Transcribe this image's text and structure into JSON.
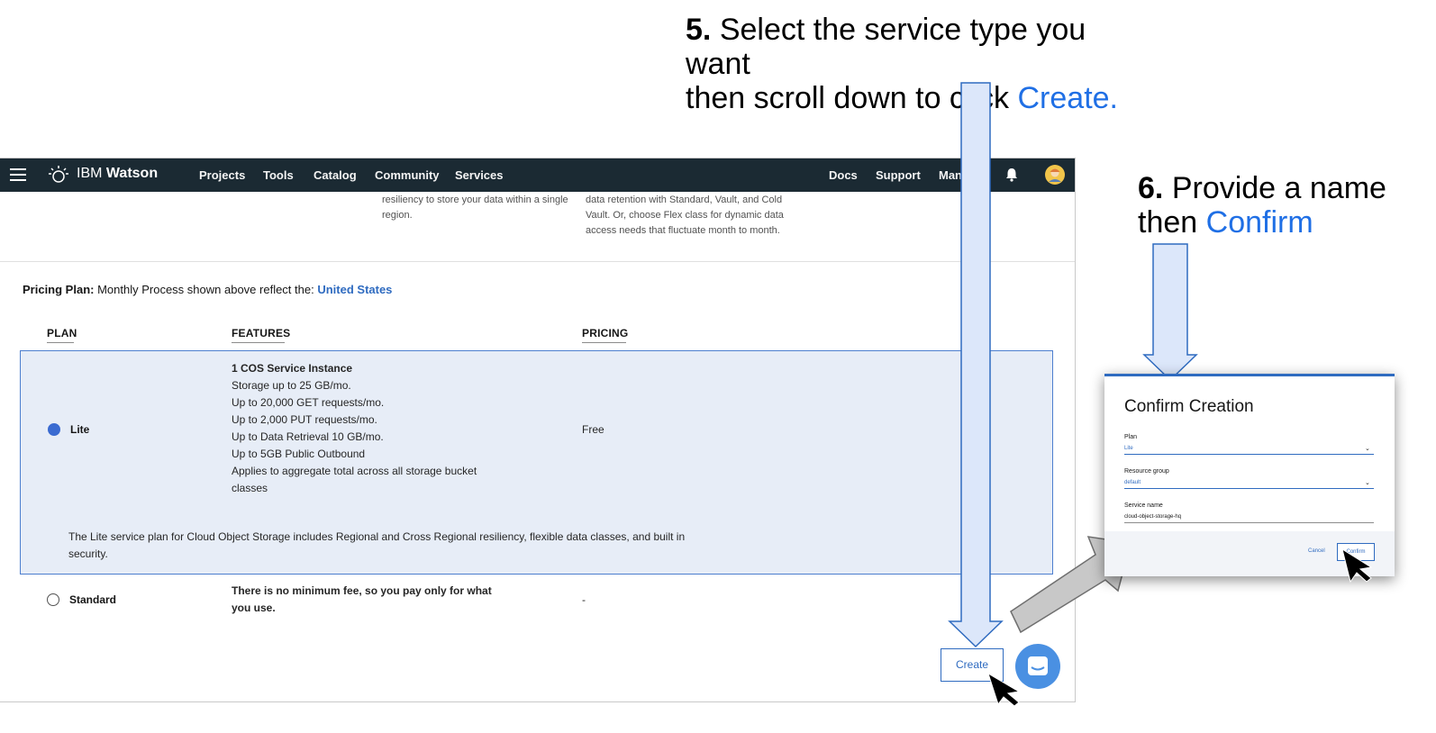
{
  "step5": {
    "number": "5.",
    "line1": "Select the service type you want",
    "line2_prefix": "then scroll down to click",
    "line2_accent": "Create."
  },
  "step6": {
    "number": "6.",
    "line1": "Provide a name",
    "line2_prefix": "then",
    "line2_accent": "Confirm"
  },
  "nav": {
    "brand_prefix": "IBM",
    "brand_name": "Watson",
    "items": [
      "Projects",
      "Tools",
      "Catalog",
      "Community",
      "Services"
    ],
    "right_items": [
      "Docs",
      "Support",
      "Mana"
    ]
  },
  "storage_classes": {
    "regional_desc": [
      "resiliency to store your data within a single",
      "region."
    ],
    "flex_desc": [
      "data retention with Standard, Vault, and Cold",
      "Vault. Or, choose Flex class for dynamic data",
      "access needs that fluctuate month to month."
    ]
  },
  "pricing_plan": {
    "label": "Pricing Plan:",
    "text": "Monthly Process shown above reflect the:",
    "region": "United States"
  },
  "table": {
    "headers": [
      "PLAN",
      "FEATURES",
      "PRICING"
    ],
    "lite": {
      "name": "Lite",
      "selected": true,
      "features_title": "1 COS Service Instance",
      "features": [
        "Storage up to 25 GB/mo.",
        "Up to 20,000 GET requests/mo.",
        "Up to 2,000 PUT requests/mo.",
        "Up to Data Retrieval 10 GB/mo.",
        "Up to 5GB Public Outbound",
        "Applies to aggregate total across all storage bucket",
        "classes"
      ],
      "price": "Free",
      "description_line1": "The Lite service plan for Cloud Object Storage includes Regional and Cross Regional resiliency, flexible data classes, and built in",
      "description_line2": "security."
    },
    "standard": {
      "name": "Standard",
      "selected": false,
      "features_line1": "There is no minimum fee, so you pay only for what",
      "features_line2": "you use.",
      "price": "-"
    }
  },
  "create_button": "Create",
  "modal": {
    "title": "Confirm Creation",
    "plan_label": "Plan",
    "plan_value": "Lite",
    "group_label": "Resource group",
    "group_value": "default",
    "name_label": "Service name",
    "name_value": "cloud-object-storage-hq",
    "cancel": "Cancel",
    "confirm": "Confirm"
  },
  "colors": {
    "accent": "#1f6fe5",
    "nav_bg": "#1b2a33",
    "selected_bg": "#e7edf7",
    "link": "#2f6bc0"
  }
}
